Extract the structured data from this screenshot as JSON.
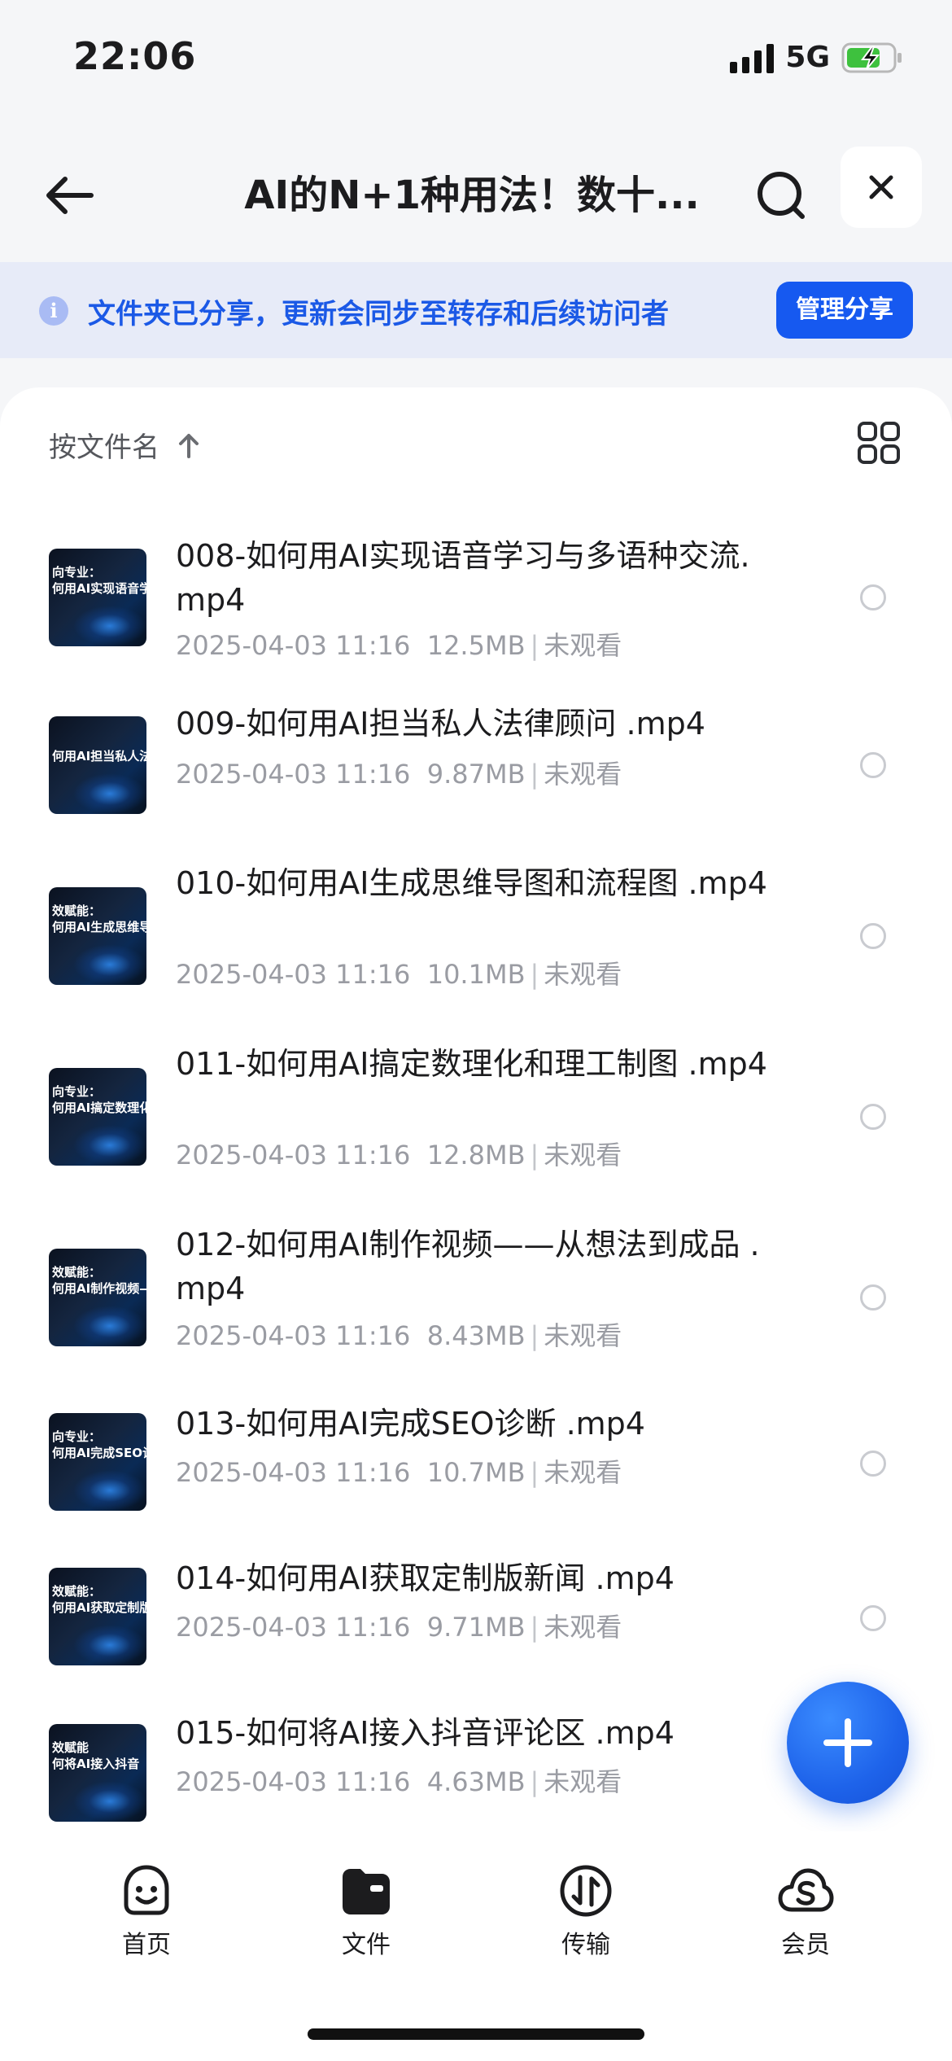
{
  "status_bar": {
    "time": "22:06",
    "network": "5G"
  },
  "header": {
    "title": "AI的N+1种用法！数十..."
  },
  "banner": {
    "text": "文件夹已分享，更新会同步至转存和后续访问者",
    "manage_label": "管理分享",
    "accent": "#1659f0"
  },
  "sort": {
    "label": "按文件名"
  },
  "files": [
    {
      "name": "008-如何用AI实现语音学习与多语种交流.mp4",
      "date": "2025-04-03 11:16",
      "size": "12.5MB",
      "status": "未观看",
      "thumb_l1": "向专业：",
      "thumb_l2": "何用AI实现语音学"
    },
    {
      "name": "009-如何用AI担当私人法律顾问 .mp4",
      "date": "2025-04-03 11:16",
      "size": "9.87MB",
      "status": "未观看",
      "thumb_l1": "",
      "thumb_l2": "何用AI担当私人法"
    },
    {
      "name": "010-如何用AI生成思维导图和流程图 .mp4",
      "date": "2025-04-03 11:16",
      "size": "10.1MB",
      "status": "未观看",
      "thumb_l1": "效赋能：",
      "thumb_l2": "何用AI生成思维导"
    },
    {
      "name": "011-如何用AI搞定数理化和理工制图 .mp4",
      "date": "2025-04-03 11:16",
      "size": "12.8MB",
      "status": "未观看",
      "thumb_l1": "向专业：",
      "thumb_l2": "何用AI搞定数理化"
    },
    {
      "name": "012-如何用AI制作视频——从想法到成品 .mp4",
      "date": "2025-04-03 11:16",
      "size": "8.43MB",
      "status": "未观看",
      "thumb_l1": "效赋能：",
      "thumb_l2": "何用AI制作视频—"
    },
    {
      "name": "013-如何用AI完成SEO诊断 .mp4",
      "date": "2025-04-03 11:16",
      "size": "10.7MB",
      "status": "未观看",
      "thumb_l1": "向专业：",
      "thumb_l2": "何用AI完成SEO诊"
    },
    {
      "name": "014-如何用AI获取定制版新闻 .mp4",
      "date": "2025-04-03 11:16",
      "size": "9.71MB",
      "status": "未观看",
      "thumb_l1": "效赋能：",
      "thumb_l2": "何用AI获取定制版"
    },
    {
      "name": "015-如何将AI接入抖音评论区 .mp4",
      "date": "2025-04-03 11:16",
      "size": "4.63MB",
      "status": "未观看",
      "thumb_l1": "效赋能",
      "thumb_l2": "何将AI接入抖音"
    }
  ],
  "tabs": [
    {
      "label": "首页",
      "icon": "smile-face-icon"
    },
    {
      "label": "文件",
      "icon": "folder-icon"
    },
    {
      "label": "传输",
      "icon": "transfer-icon"
    },
    {
      "label": "会员",
      "icon": "cloud-s-icon"
    }
  ]
}
